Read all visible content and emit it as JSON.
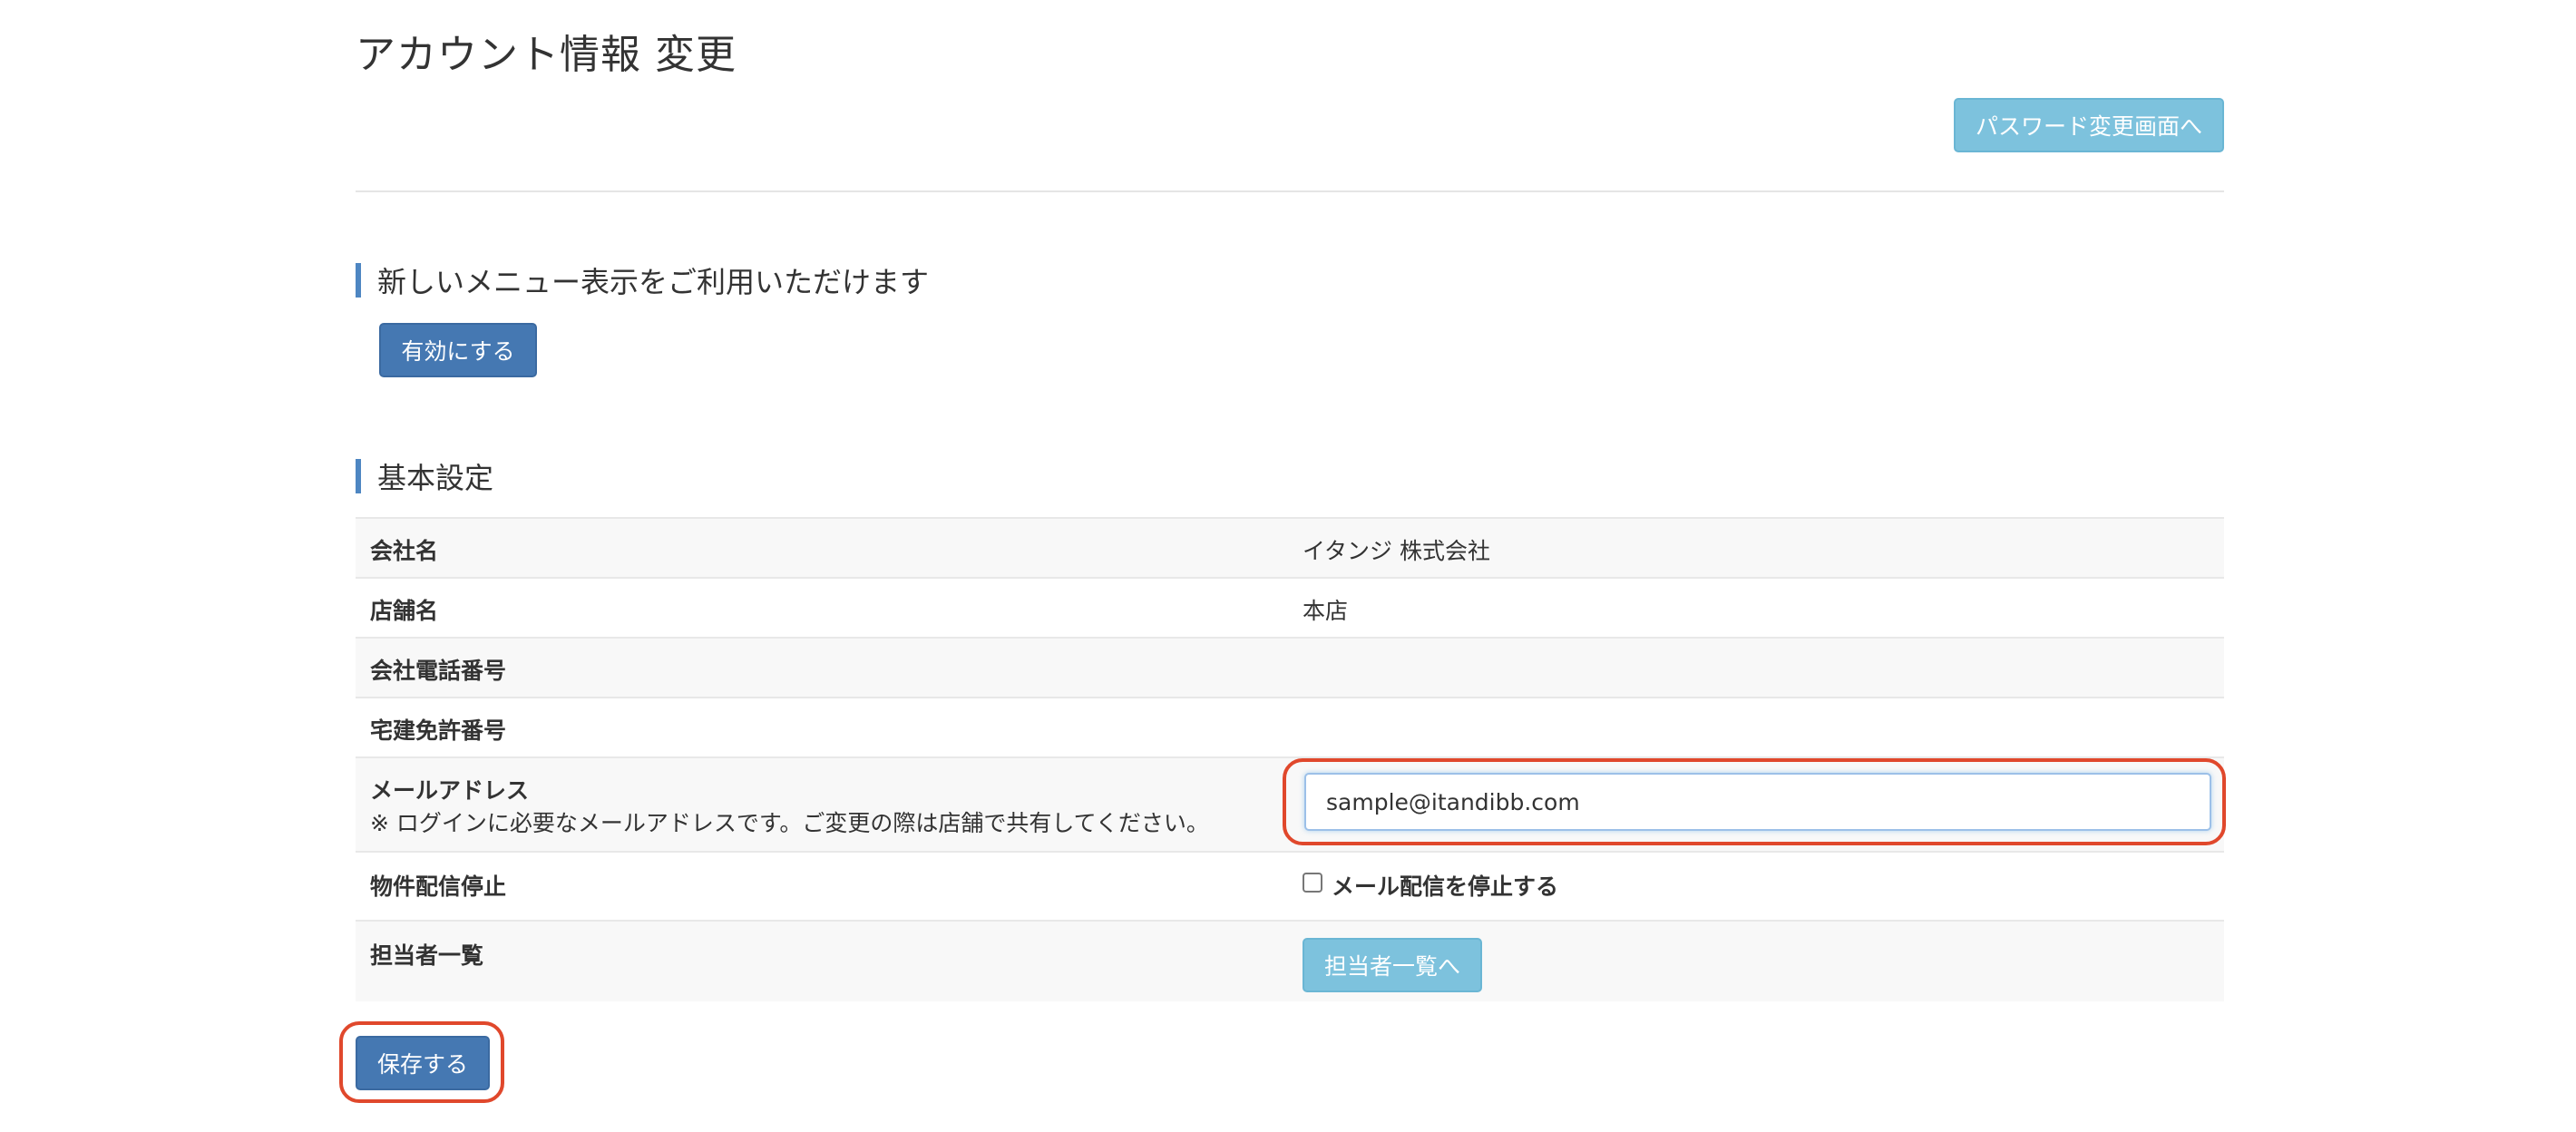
{
  "header": {
    "title": "アカウント情報 変更",
    "password_button": "パスワード変更画面へ"
  },
  "menu_section": {
    "heading": "新しいメニュー表示をご利用いただけます",
    "enable_button": "有効にする"
  },
  "basic_section": {
    "heading": "基本設定",
    "rows": {
      "company_name": {
        "label": "会社名",
        "value": "イタンジ 株式会社"
      },
      "store_name": {
        "label": "店舗名",
        "value": "本店"
      },
      "company_phone": {
        "label": "会社電話番号",
        "value": ""
      },
      "license_number": {
        "label": "宅建免許番号",
        "value": ""
      },
      "email": {
        "label": "メールアドレス",
        "note": "※ ログインに必要なメールアドレスです。ご変更の際は店舗で共有してください。",
        "value": "sample@itandibb.com"
      },
      "delivery_stop": {
        "label": "物件配信停止",
        "checkbox_label": "メール配信を停止する",
        "checked": false
      },
      "staff_list": {
        "label": "担当者一覧",
        "button": "担当者一覧へ"
      }
    }
  },
  "footer": {
    "save_button": "保存する"
  },
  "colors": {
    "primary": "#4578b2",
    "info": "#7dc2dd",
    "highlight_ring": "#e0482c",
    "heading_bar": "#4e86c2"
  }
}
